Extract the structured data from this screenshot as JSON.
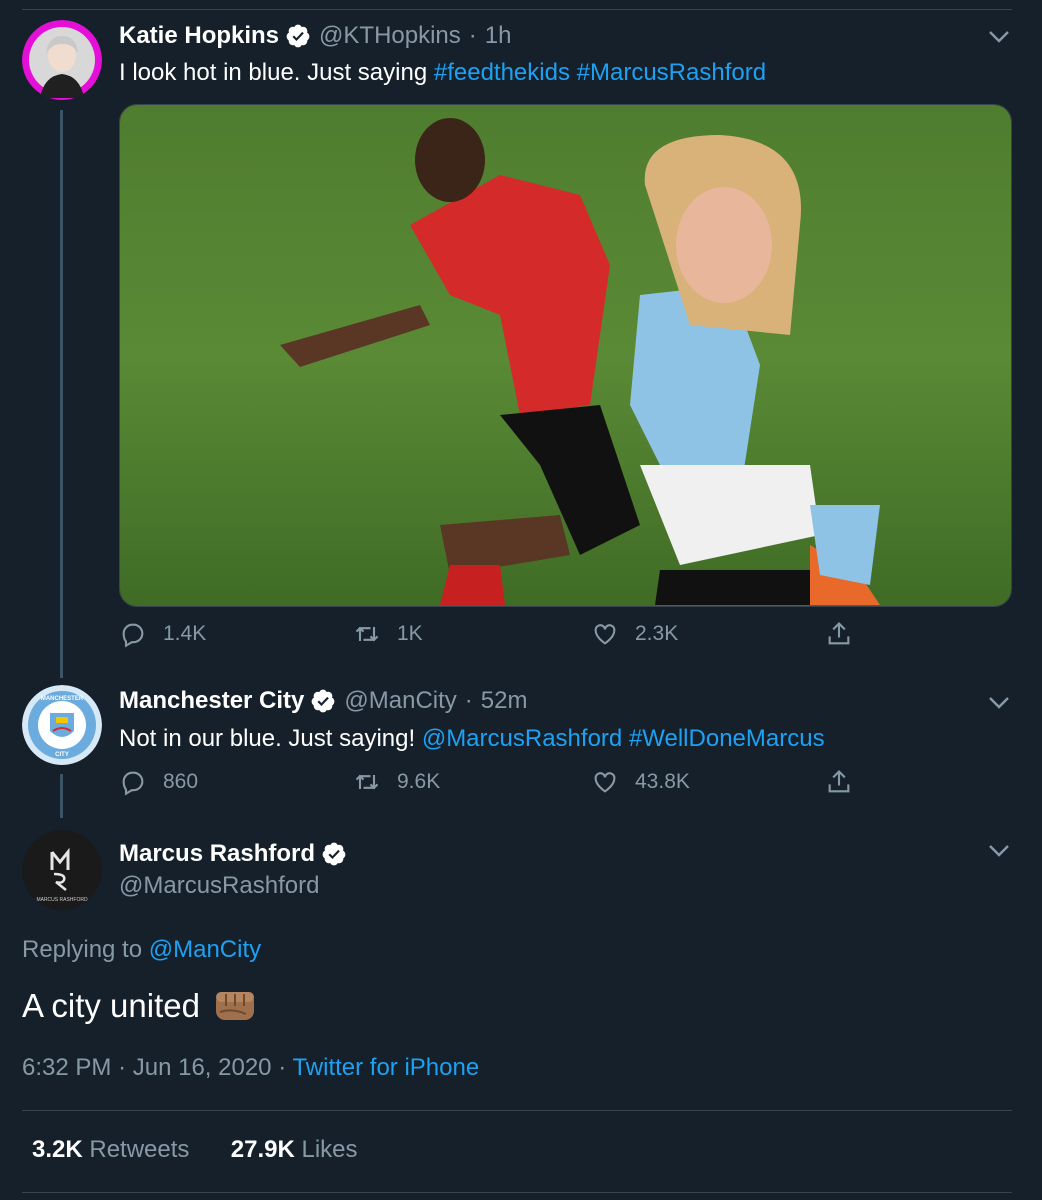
{
  "tweet1": {
    "name": "Katie Hopkins",
    "handle": "@KTHopkins",
    "time": "1h",
    "text": "I look hot in blue. Just saying ",
    "hashtag1": "#feedthekids",
    "hashtag2": "#MarcusRashford",
    "replies": "1.4K",
    "retweets": "1K",
    "likes": "2.3K"
  },
  "tweet2": {
    "name": "Manchester City",
    "handle": "@ManCity",
    "time": "52m",
    "text": "Not in our blue. Just saying! ",
    "mention": "@MarcusRashford",
    "hashtag": "#WellDoneMarcus",
    "replies": "860",
    "retweets": "9.6K",
    "likes": "43.8K",
    "logo_text_top": "MANCHESTER",
    "logo_text_bottom": "CITY"
  },
  "tweet3": {
    "name": "Marcus Rashford",
    "handle": "@MarcusRashford",
    "avatar_letters": "MR",
    "avatar_caption": "MARCUS RASHFORD",
    "replying_label": "Replying to ",
    "replying_to": "@ManCity",
    "text": "A city united",
    "time": "6:32 PM",
    "date": "Jun 16, 2020",
    "source": "Twitter for iPhone",
    "retweets_count": "3.2K",
    "retweets_label": "Retweets",
    "likes_count": "27.9K",
    "likes_label": "Likes"
  },
  "separator": "·",
  "colors": {
    "background": "#15202b",
    "link": "#1da1f2",
    "muted": "#8899a6",
    "divider": "#38444d",
    "verified": "#ffffff"
  },
  "icons": [
    "verified-badge-icon",
    "chevron-down-icon",
    "reply-icon",
    "retweet-icon",
    "like-icon",
    "share-icon",
    "fist-emoji-icon"
  ]
}
